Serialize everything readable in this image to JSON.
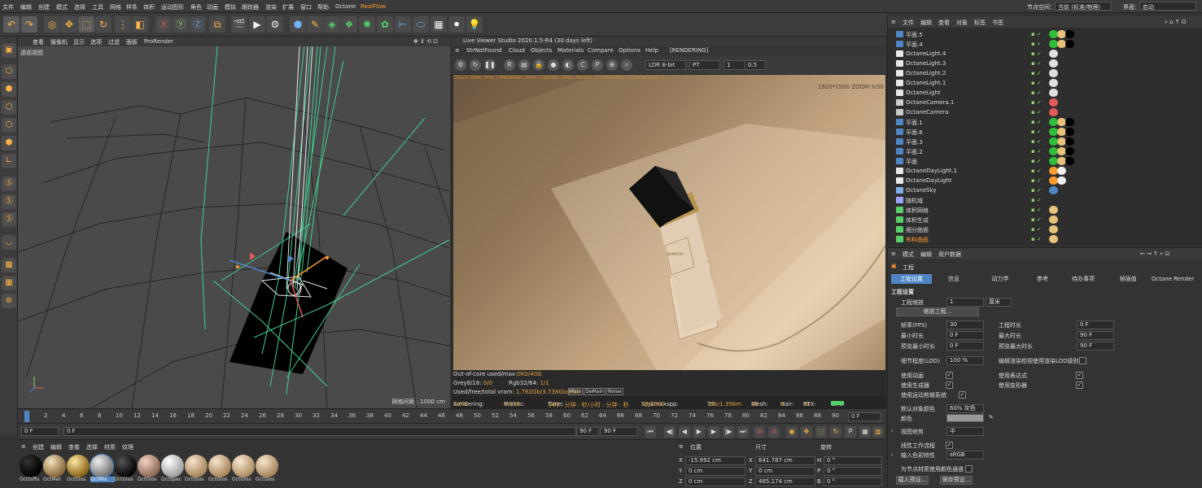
{
  "menubar": {
    "items": [
      "文件",
      "编辑",
      "创建",
      "模式",
      "选择",
      "工具",
      "网格",
      "样条",
      "体积",
      "运动图形",
      "角色",
      "动画",
      "模拟",
      "跟踪器",
      "渲染",
      "扩展",
      "窗口",
      "帮助",
      "Octane",
      "RealFlow"
    ],
    "node_space_label": "节点空间：",
    "node_space_value": "当前 (标准/物理)",
    "layout_label": "界面：",
    "layout_value": "启动"
  },
  "viewport": {
    "menu": [
      "查看",
      "摄像机",
      "显示",
      "选项",
      "过滤",
      "面板",
      "ProRender"
    ],
    "label": "透视视图",
    "grid": "网格间距 : 1000 cm"
  },
  "live_viewer": {
    "title": "Live Viewer Studio 2020.1.5-R4 (30 days left)",
    "menu": [
      "StrNotFound",
      "Cloud",
      "Objects",
      "Materials",
      "Compare",
      "Options",
      "Help",
      "[RENDERING]"
    ],
    "bitdepth": "LDR 8-bit",
    "kernel": "PT",
    "value1": "1",
    "value2": "0.5",
    "render_message": "Check time: 0ms / MeshGen: 0ms / Update: 0ms / Nodes: 0 / Movable: 13 txCached: 2",
    "resolution": "1920*1500 ZOOM:%50",
    "stats": {
      "out_of_core_label": "Out-of-core used/max:",
      "out_of_core_value": "0Kb/4Gb",
      "grey_label": "Grey8/16:",
      "grey_value": "0/0",
      "rgb_label": "Rgb32/64:",
      "rgb_value": "1/1",
      "vram_label": "Used/free/total vram:",
      "vram_value": "1.762Gb/3.738Gb/8Gb"
    },
    "tabs": [
      "Main",
      "DeMain",
      "Noise"
    ],
    "status": {
      "rendering_label": "Rendering:",
      "rendering_value": "2.6%",
      "mssec_label": "Ms/sec:",
      "mssec_value": "6.329",
      "time_label": "Time:",
      "time_value": "小时 : 分钟 : 秒/小时 : 分钟 : 秒",
      "spp_label": "Spp/maxspp:",
      "spp_value": "26/1000",
      "tri_label": "Tri:",
      "tri_value": "13k/1.396m",
      "mesh_label": "Mesh:",
      "mesh_value": "18",
      "hair_label": "Hair:",
      "hair_value": "0",
      "rtx_label": "RTX:",
      "rtx_value": "on",
      "gpu_label": "GPU:",
      "gpu_value": "65"
    },
    "bottle_brand": "GIVENCHY"
  },
  "timeline": {
    "ticks": [
      "0",
      "2",
      "4",
      "6",
      "8",
      "10",
      "12",
      "14",
      "16",
      "18",
      "20",
      "22",
      "24",
      "26",
      "28",
      "30",
      "32",
      "34",
      "36",
      "38",
      "40",
      "42",
      "44",
      "46",
      "48",
      "50",
      "52",
      "54",
      "56",
      "58",
      "60",
      "62",
      "64",
      "66",
      "68",
      "70",
      "72",
      "74",
      "76",
      "78",
      "80",
      "82",
      "84",
      "86",
      "88",
      "90"
    ],
    "current_frame": "0 F",
    "start": "0 F",
    "start2": "0 F",
    "end": "90 F",
    "end2": "90 F"
  },
  "materials": {
    "menu": [
      "创建",
      "编辑",
      "查看",
      "选择",
      "材质",
      "纹理"
    ],
    "items": [
      "OctDiffu",
      "OctMet",
      "OctGlos",
      "OctMix",
      "OctGlos",
      "OctGlos",
      "OctSpec",
      "OctGlos",
      "OctGlos",
      "OctGlos",
      "OctGlos"
    ],
    "selected_index": 3
  },
  "coordinates": {
    "headers": [
      "位置",
      "尺寸",
      "旋转"
    ],
    "rows": [
      {
        "axis": "X",
        "pos": "-15.992 cm",
        "size_axis": "X",
        "size": "641.787 cm",
        "rot_axis": "H",
        "rot": "0 °"
      },
      {
        "axis": "Y",
        "pos": "0 cm",
        "size_axis": "Y",
        "size": "0 cm",
        "rot_axis": "P",
        "rot": "0 °"
      },
      {
        "axis": "Z",
        "pos": "0 cm",
        "size_axis": "Z",
        "size": "485.174 cm",
        "rot_axis": "B",
        "rot": "0 °"
      }
    ]
  },
  "objects": {
    "menu": [
      "文件",
      "编辑",
      "查看",
      "对象",
      "标签",
      "书签"
    ],
    "items": [
      {
        "name": "平面.5",
        "type": "plane"
      },
      {
        "name": "平面.4",
        "type": "plane"
      },
      {
        "name": "OctaneLight.4",
        "type": "light"
      },
      {
        "name": "OctaneLight.3",
        "type": "light"
      },
      {
        "name": "OctaneLight.2",
        "type": "light"
      },
      {
        "name": "OctaneLight.1",
        "type": "light"
      },
      {
        "name": "OctaneLight",
        "type": "light"
      },
      {
        "name": "OctaneCamera.1",
        "type": "camera"
      },
      {
        "name": "OctaneCamera",
        "type": "camera"
      },
      {
        "name": "平面.1",
        "type": "plane"
      },
      {
        "name": "平面.6",
        "type": "plane"
      },
      {
        "name": "平面.3",
        "type": "plane"
      },
      {
        "name": "平面.2",
        "type": "plane"
      },
      {
        "name": "平面",
        "type": "plane"
      },
      {
        "name": "OctaneDayLight.1",
        "type": "daylight"
      },
      {
        "name": "OctaneDayLight",
        "type": "daylight"
      },
      {
        "name": "OctaneSky",
        "type": "sky"
      },
      {
        "name": "随机域",
        "type": "field"
      },
      {
        "name": "体积网格",
        "type": "volume"
      },
      {
        "name": "体积生成",
        "type": "volume"
      },
      {
        "name": "细分曲面",
        "type": "subdiv"
      },
      {
        "name": "布料曲面",
        "type": "cloth"
      }
    ]
  },
  "attributes": {
    "menu": [
      "模式",
      "编辑",
      "用户数据"
    ],
    "section": "工程",
    "tabs": [
      "工程设置",
      "信息",
      "动力学",
      "参考",
      "待办事项",
      "帧插值",
      "Octane Render"
    ],
    "group_title": "工程设置",
    "project_scale_label": "工程缩放",
    "project_scale_value": "1",
    "project_scale_unit": "厘米",
    "scale_project_button": "缩放工程...",
    "fps_label": "帧率(FPS)",
    "fps_value": "30",
    "project_time_label": "工程时长",
    "project_time_value": "0 F",
    "min_time_label": "最小时长",
    "min_time_value": "0 F",
    "max_time_label": "最大时长",
    "max_time_value": "90 F",
    "preview_min_label": "预览最小时长",
    "preview_min_value": "0 F",
    "preview_max_label": "预览最大时长",
    "preview_max_value": "90 F",
    "lod_label": "细节程度(LOD)",
    "lod_value": "100 %",
    "lod_editor_label": "编辑渲染检视使用渲染LOD级别",
    "use_animation": "使用动画",
    "use_expression": "使用表达式",
    "use_generator": "使用生成器",
    "use_deformer": "使用变形器",
    "use_motion_system": "使用运动剪辑系统",
    "default_color_label": "默认对象颜色",
    "default_color_value": "60% 灰色",
    "color_label": "颜色",
    "view_clip_label": "视图修剪",
    "view_clip_value": "中",
    "linear_workflow": "线性工作流程",
    "input_color_label": "输入色彩特性",
    "input_color_value": "sRGB",
    "node_color_label": "为节点材质使用颜色通道",
    "load_preset": "载入预设...",
    "save_preset": "保存预设..."
  }
}
